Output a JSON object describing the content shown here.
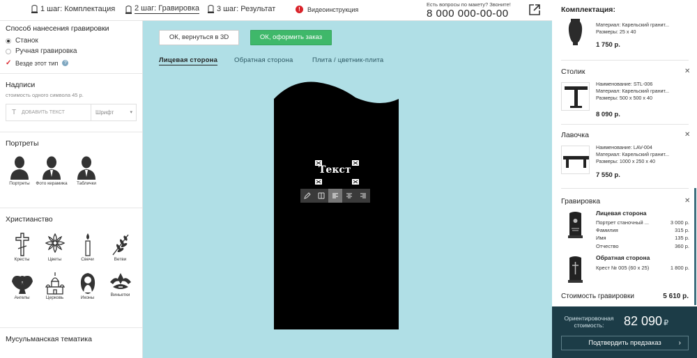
{
  "topbar": {
    "steps": [
      {
        "label": "1 шаг: Комплектация"
      },
      {
        "label": "2 шаг: Гравировка"
      },
      {
        "label": "3 шаг: Результат"
      }
    ],
    "video_label": "Видеоинструкция",
    "phone_note": "Есть вопросы по макету? Звоните!",
    "phone": "8 000 000-00-00"
  },
  "left": {
    "method_title": "Способ нанесения гравировки",
    "method_options": [
      "Станок",
      "Ручная гравировка"
    ],
    "everywhere_label": "Везде этот тип",
    "inscriptions_title": "Надписи",
    "symbol_cost": "стоимость одного символа 45 р.",
    "add_text_icon": "T",
    "add_text_placeholder": "ДОБАВИТЬ ТЕКСТ",
    "font_label": "Шрифт",
    "portraits_title": "Портреты",
    "portraits": [
      {
        "label": "Портреты",
        "icon": "person-icon"
      },
      {
        "label": "Фото керамика",
        "icon": "person-suit-icon"
      },
      {
        "label": "Таблички",
        "icon": "person-suit-icon"
      }
    ],
    "christian_title": "Христианство",
    "christian": [
      {
        "label": "Кресты",
        "icon": "cross-icon"
      },
      {
        "label": "Цветы",
        "icon": "flower-icon"
      },
      {
        "label": "Свечи",
        "icon": "candle-icon"
      },
      {
        "label": "Ветви",
        "icon": "branch-icon"
      },
      {
        "label": "Ангелы",
        "icon": "angel-icon"
      },
      {
        "label": "Церковь",
        "icon": "church-icon"
      },
      {
        "label": "Иконы",
        "icon": "icon-image-icon"
      },
      {
        "label": "Виньетки",
        "icon": "vignette-icon"
      }
    ],
    "muslim_title": "Мусульманская тематика"
  },
  "center": {
    "back_3d": "ОК, вернуться в 3D",
    "order": "ОК, оформить заказ",
    "tabs": [
      "Лицевая сторона",
      "Обратная сторона",
      "Плита / цветник-плита"
    ],
    "selected_text": "Текст"
  },
  "right": {
    "header": "Комплектация:",
    "top_item": {
      "material": "Материал: Карельский гранит...",
      "size": "Размеры: 25 х 40",
      "price": "1 750 р."
    },
    "table": {
      "title": "Столик",
      "name": "Наименование: STL-006",
      "material": "Материал: Карельский гранит...",
      "size": "Размеры: 500 х 500 х 40",
      "price": "8 090 р."
    },
    "bench": {
      "title": "Лавочка",
      "name": "Наименование: LAV-004",
      "material": "Материал: Карельский гранит...",
      "size": "Размеры: 1000 х 250 х 40",
      "price": "7 550 р."
    },
    "engraving": {
      "title": "Гравировка",
      "front_title": "Лицевая сторона",
      "front_rows": [
        {
          "name": "Портрет станочный ...",
          "price": "3 000 р."
        },
        {
          "name": "Фамилия",
          "price": "315 р."
        },
        {
          "name": "Имя",
          "price": "135 р."
        },
        {
          "name": "Отчество",
          "price": "360 р."
        }
      ],
      "back_title": "Обратная сторона",
      "back_rows": [
        {
          "name": "Крест № 005 (60 х 25)",
          "price": "1 800 р."
        }
      ],
      "cost_label": "Стоимость гравировки",
      "cost_value": "5 610 р."
    },
    "estimate_label": "Ориентировочная стоимость:",
    "estimate_value": "82 090",
    "estimate_currency": "₽",
    "confirm_label": "Подтвердить предзаказ"
  },
  "colors": {
    "canvas_bg": "#b0dfe6",
    "green": "#3fb86a",
    "dark_panel": "#1c3c47",
    "red": "#d9232a"
  }
}
